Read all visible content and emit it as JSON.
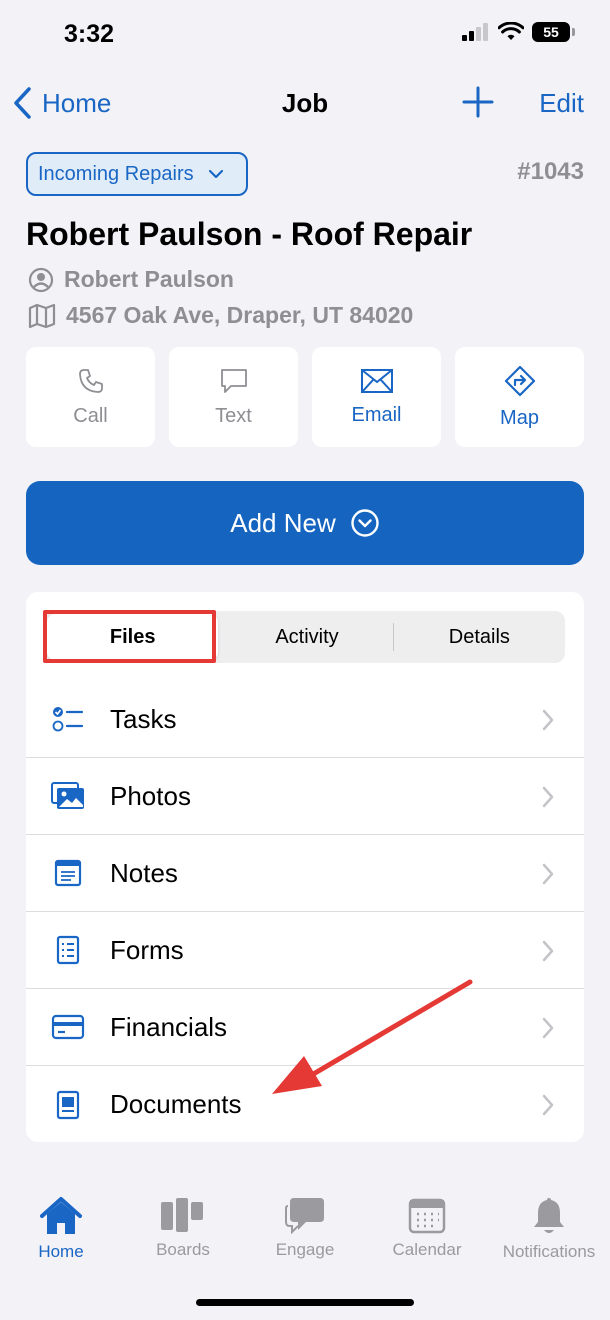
{
  "status_bar": {
    "time": "3:32",
    "battery": "55"
  },
  "nav": {
    "back_label": "Home",
    "title": "Job",
    "edit_label": "Edit"
  },
  "job": {
    "stage": "Incoming Repairs",
    "number": "#1043",
    "title": "Robert Paulson - Roof Repair",
    "contact": "Robert Paulson",
    "address": "4567 Oak Ave, Draper, UT 84020"
  },
  "actions": [
    {
      "label": "Call",
      "icon": "phone-icon",
      "enabled": false
    },
    {
      "label": "Text",
      "icon": "chat-bubble-icon",
      "enabled": false
    },
    {
      "label": "Email",
      "icon": "envelope-icon",
      "enabled": true
    },
    {
      "label": "Map",
      "icon": "directions-icon",
      "enabled": true
    }
  ],
  "add_new": {
    "label": "Add New"
  },
  "segments": {
    "files": "Files",
    "activity": "Activity",
    "details": "Details",
    "selected": "Files"
  },
  "files_list": [
    {
      "label": "Tasks",
      "icon": "checklist-icon"
    },
    {
      "label": "Photos",
      "icon": "photos-icon"
    },
    {
      "label": "Notes",
      "icon": "notes-icon"
    },
    {
      "label": "Forms",
      "icon": "form-icon"
    },
    {
      "label": "Financials",
      "icon": "credit-card-icon"
    },
    {
      "label": "Documents",
      "icon": "document-icon"
    }
  ],
  "tabbar": [
    {
      "label": "Home",
      "icon": "home-icon",
      "active": true
    },
    {
      "label": "Boards",
      "icon": "boards-icon",
      "active": false
    },
    {
      "label": "Engage",
      "icon": "chat-icon",
      "active": false
    },
    {
      "label": "Calendar",
      "icon": "calendar-icon",
      "active": false
    },
    {
      "label": "Notifications",
      "icon": "bell-icon",
      "active": false
    }
  ],
  "colors": {
    "accent": "#1a66c4",
    "primary_button": "#1565c0",
    "annotation": "#e53935",
    "muted": "#8e8e93"
  }
}
